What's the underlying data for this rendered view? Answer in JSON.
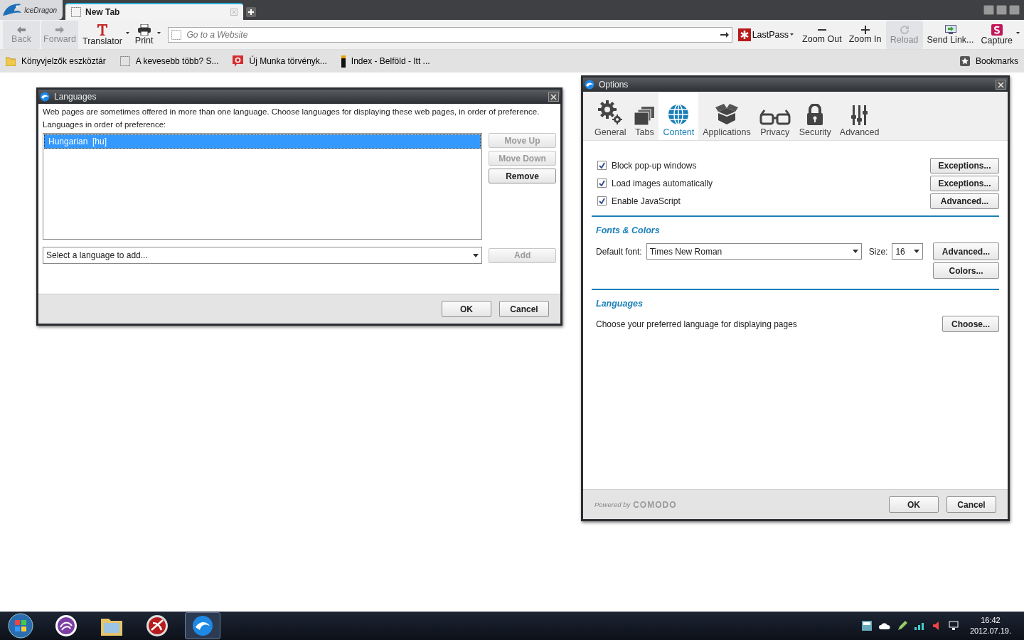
{
  "browser": {
    "app_name": "IceDragon",
    "tabs": [
      {
        "title": "New Tab",
        "selected": true
      }
    ],
    "toolbar_left": [
      {
        "label": "Back",
        "kind": "back",
        "disabled": true
      },
      {
        "label": "Forward",
        "kind": "forward",
        "disabled": true
      },
      {
        "label": "Translator",
        "kind": "translator",
        "disabled": false,
        "dropdown": true
      },
      {
        "label": "Print",
        "kind": "print",
        "disabled": false,
        "dropdown": true
      }
    ],
    "address": {
      "placeholder": "Go to a Website"
    },
    "lastpass": {
      "label": "LastPass"
    },
    "toolbar_right": [
      {
        "label": "Zoom Out",
        "kind": "zoomout",
        "disabled": false
      },
      {
        "label": "Zoom In",
        "kind": "zoomin",
        "disabled": false
      },
      {
        "label": "Reload",
        "kind": "reload",
        "disabled": true
      },
      {
        "label": "Send Link...",
        "kind": "send",
        "disabled": false
      },
      {
        "label": "Capture",
        "kind": "capture",
        "disabled": false,
        "dropdown": true
      }
    ],
    "bookmarks": [
      {
        "label": "Könyvjelzők eszköztár",
        "kind": "folder"
      },
      {
        "label": "A kevesebb több? S...",
        "kind": "page"
      },
      {
        "label": "Új Munka törvényk...",
        "kind": "red"
      },
      {
        "label": "Index - Belföld - Itt ...",
        "kind": "index"
      }
    ],
    "bookmarks_menu": "Bookmarks"
  },
  "languages_dialog": {
    "title": "Languages",
    "intro": "Web pages are sometimes offered in more than one language. Choose languages for displaying these web pages, in order of preference.",
    "list_label": "Languages in order of preference:",
    "languages": [
      {
        "label": "Hungarian  [hu]",
        "selected": true
      }
    ],
    "side_buttons": [
      {
        "label": "Move Up",
        "disabled": true
      },
      {
        "label": "Move Down",
        "disabled": true
      },
      {
        "label": "Remove",
        "disabled": false
      }
    ],
    "add_select": {
      "placeholder": "Select a language to add..."
    },
    "add_button": {
      "label": "Add",
      "disabled": true
    },
    "footer_buttons": [
      "OK",
      "Cancel"
    ]
  },
  "options_dialog": {
    "title": "Options",
    "categories": [
      {
        "label": "General",
        "kind": "general",
        "selected": false
      },
      {
        "label": "Tabs",
        "kind": "tabs",
        "selected": false
      },
      {
        "label": "Content",
        "kind": "content",
        "selected": true
      },
      {
        "label": "Applications",
        "kind": "applications",
        "selected": false
      },
      {
        "label": "Privacy",
        "kind": "privacy",
        "selected": false
      },
      {
        "label": "Security",
        "kind": "security",
        "selected": false
      },
      {
        "label": "Advanced",
        "kind": "advanced",
        "selected": false
      }
    ],
    "checks": [
      {
        "label": "Block pop-up windows",
        "checked": true,
        "button": "Exceptions..."
      },
      {
        "label": "Load images automatically",
        "checked": true,
        "button": "Exceptions..."
      },
      {
        "label": "Enable JavaScript",
        "checked": true,
        "button": "Advanced..."
      }
    ],
    "fonts": {
      "heading": "Fonts & Colors",
      "font_label": "Default font:",
      "font": "Times New Roman",
      "size_label": "Size:",
      "size": "16",
      "buttons": [
        "Advanced...",
        "Colors..."
      ]
    },
    "languages": {
      "heading": "Languages",
      "text": "Choose your preferred language for displaying pages",
      "button": "Choose..."
    },
    "powered_by": "Powered by",
    "brand": "COMODO",
    "footer_buttons": [
      "OK",
      "Cancel"
    ]
  },
  "taskbar": {
    "items": [
      {
        "kind": "start",
        "selected": false
      },
      {
        "kind": "torrent",
        "selected": false
      },
      {
        "kind": "explorer",
        "selected": false
      },
      {
        "kind": "game",
        "selected": false
      },
      {
        "kind": "dragon",
        "selected": true
      }
    ],
    "time": "16:42",
    "date": "2012.07.19."
  }
}
